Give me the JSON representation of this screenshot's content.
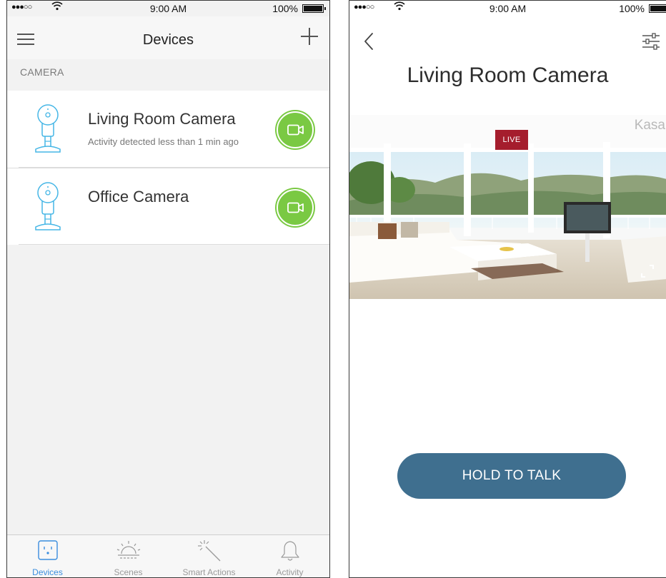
{
  "left_screen": {
    "status_bar": {
      "signal": "●●●○○",
      "time": "9:00 AM",
      "battery": "100%"
    },
    "nav": {
      "title": "Devices"
    },
    "section_header": "CAMERA",
    "devices": [
      {
        "name": "Living Room Camera",
        "subtitle": "Activity detected less than 1 min ago"
      },
      {
        "name": "Office Camera",
        "subtitle": ""
      }
    ],
    "tabs": [
      {
        "label": "Devices",
        "icon": "plug-icon",
        "active": true
      },
      {
        "label": "Scenes",
        "icon": "sunrise-icon",
        "active": false
      },
      {
        "label": "Smart Actions",
        "icon": "magic-wand-icon",
        "active": false
      },
      {
        "label": "Activity",
        "icon": "bell-icon",
        "active": false
      }
    ],
    "colors": {
      "accent_green": "#7ac943",
      "active_tab": "#3a8dde",
      "camera_icon": "#45b6e6"
    }
  },
  "right_screen": {
    "status_bar": {
      "signal": "●●●○○",
      "time": "9:00 AM",
      "battery": "100%"
    },
    "title": "Living Room Camera",
    "live_badge": "LIVE",
    "watermark": "Kasa",
    "hold_to_talk": "HOLD TO TALK",
    "colors": {
      "live_badge": "#a51d2d",
      "talk_button": "#3f6f8f"
    }
  }
}
